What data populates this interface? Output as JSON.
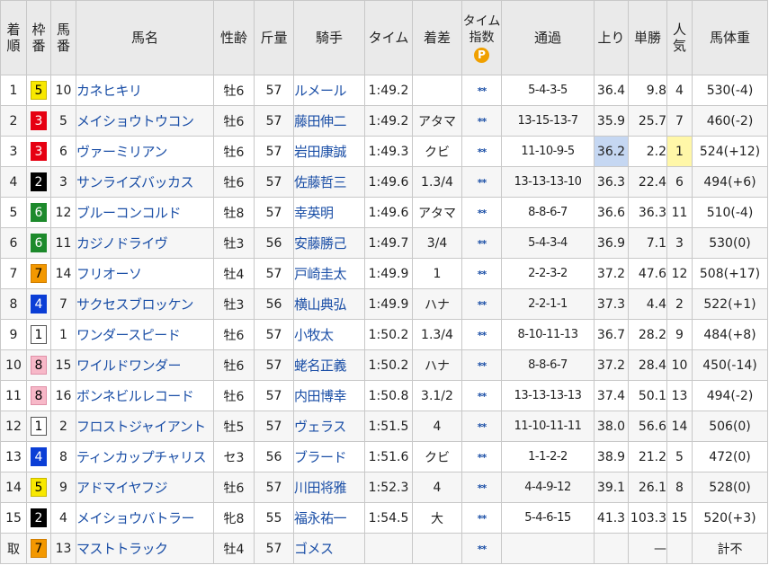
{
  "headers": {
    "rank": [
      "着",
      "順"
    ],
    "waku": [
      "枠",
      "番"
    ],
    "umaban": [
      "馬",
      "番"
    ],
    "horse": "馬名",
    "sexage": "性齢",
    "weight": "斤量",
    "jockey": "騎手",
    "time": "タイム",
    "margin": "着差",
    "index": [
      "タイム",
      "指数"
    ],
    "index_icon": "P",
    "passing": "通過",
    "agari": "上り",
    "odds": "単勝",
    "pop": [
      "人",
      "気"
    ],
    "bodyweight": "馬体重"
  },
  "waku_colors": {
    "1": "#ffffff",
    "2": "#000000",
    "3": "#e60012",
    "4": "#0b3ed6",
    "5": "#f8e800",
    "6": "#1d8a2c",
    "7": "#f39800",
    "8": "#f7b8c8"
  },
  "rows": [
    {
      "rank": "1",
      "waku": "5",
      "umaban": "10",
      "horse": "カネヒキリ",
      "sexage": "牡6",
      "weight": "57",
      "jockey": "ルメール",
      "time": "1:49.2",
      "margin": "",
      "index": "**",
      "passing": "5-4-3-5",
      "agari": "36.4",
      "odds": "9.8",
      "pop": "4",
      "bodyweight": "530(-4)"
    },
    {
      "rank": "2",
      "waku": "3",
      "umaban": "5",
      "horse": "メイショウトウコン",
      "sexage": "牡6",
      "weight": "57",
      "jockey": "藤田伸二",
      "time": "1:49.2",
      "margin": "アタマ",
      "index": "**",
      "passing": "13-15-13-7",
      "agari": "35.9",
      "odds": "25.7",
      "pop": "7",
      "bodyweight": "460(-2)"
    },
    {
      "rank": "3",
      "waku": "3",
      "umaban": "6",
      "horse": "ヴァーミリアン",
      "sexage": "牡6",
      "weight": "57",
      "jockey": "岩田康誠",
      "time": "1:49.3",
      "margin": "クビ",
      "index": "**",
      "passing": "11-10-9-5",
      "agari": "36.2",
      "odds": "2.2",
      "pop": "1",
      "bodyweight": "524(+12)"
    },
    {
      "rank": "4",
      "waku": "2",
      "umaban": "3",
      "horse": "サンライズバッカス",
      "sexage": "牡6",
      "weight": "57",
      "jockey": "佐藤哲三",
      "time": "1:49.6",
      "margin": "1.3/4",
      "index": "**",
      "passing": "13-13-13-10",
      "agari": "36.3",
      "odds": "22.4",
      "pop": "6",
      "bodyweight": "494(+6)"
    },
    {
      "rank": "5",
      "waku": "6",
      "umaban": "12",
      "horse": "ブルーコンコルド",
      "sexage": "牡8",
      "weight": "57",
      "jockey": "幸英明",
      "time": "1:49.6",
      "margin": "アタマ",
      "index": "**",
      "passing": "8-8-6-7",
      "agari": "36.6",
      "odds": "36.3",
      "pop": "11",
      "bodyweight": "510(-4)"
    },
    {
      "rank": "6",
      "waku": "6",
      "umaban": "11",
      "horse": "カジノドライヴ",
      "sexage": "牡3",
      "weight": "56",
      "jockey": "安藤勝己",
      "time": "1:49.7",
      "margin": "3/4",
      "index": "**",
      "passing": "5-4-3-4",
      "agari": "36.9",
      "odds": "7.1",
      "pop": "3",
      "bodyweight": "530(0)"
    },
    {
      "rank": "7",
      "waku": "7",
      "umaban": "14",
      "horse": "フリオーソ",
      "sexage": "牡4",
      "weight": "57",
      "jockey": "戸崎圭太",
      "time": "1:49.9",
      "margin": "1",
      "index": "**",
      "passing": "2-2-3-2",
      "agari": "37.2",
      "odds": "47.6",
      "pop": "12",
      "bodyweight": "508(+17)"
    },
    {
      "rank": "8",
      "waku": "4",
      "umaban": "7",
      "horse": "サクセスブロッケン",
      "sexage": "牡3",
      "weight": "56",
      "jockey": "横山典弘",
      "time": "1:49.9",
      "margin": "ハナ",
      "index": "**",
      "passing": "2-2-1-1",
      "agari": "37.3",
      "odds": "4.4",
      "pop": "2",
      "bodyweight": "522(+1)"
    },
    {
      "rank": "9",
      "waku": "1",
      "umaban": "1",
      "horse": "ワンダースピード",
      "sexage": "牡6",
      "weight": "57",
      "jockey": "小牧太",
      "time": "1:50.2",
      "margin": "1.3/4",
      "index": "**",
      "passing": "8-10-11-13",
      "agari": "36.7",
      "odds": "28.2",
      "pop": "9",
      "bodyweight": "484(+8)"
    },
    {
      "rank": "10",
      "waku": "8",
      "umaban": "15",
      "horse": "ワイルドワンダー",
      "sexage": "牡6",
      "weight": "57",
      "jockey": "蛯名正義",
      "time": "1:50.2",
      "margin": "ハナ",
      "index": "**",
      "passing": "8-8-6-7",
      "agari": "37.2",
      "odds": "28.4",
      "pop": "10",
      "bodyweight": "450(-14)"
    },
    {
      "rank": "11",
      "waku": "8",
      "umaban": "16",
      "horse": "ボンネビルレコード",
      "sexage": "牡6",
      "weight": "57",
      "jockey": "内田博幸",
      "time": "1:50.8",
      "margin": "3.1/2",
      "index": "**",
      "passing": "13-13-13-13",
      "agari": "37.4",
      "odds": "50.1",
      "pop": "13",
      "bodyweight": "494(-2)"
    },
    {
      "rank": "12",
      "waku": "1",
      "umaban": "2",
      "horse": "フロストジャイアント",
      "sexage": "牡5",
      "weight": "57",
      "jockey": "ヴェラス",
      "time": "1:51.5",
      "margin": "4",
      "index": "**",
      "passing": "11-10-11-11",
      "agari": "38.0",
      "odds": "56.6",
      "pop": "14",
      "bodyweight": "506(0)"
    },
    {
      "rank": "13",
      "waku": "4",
      "umaban": "8",
      "horse": "ティンカップチャリス",
      "sexage": "セ3",
      "weight": "56",
      "jockey": "ブラード",
      "time": "1:51.6",
      "margin": "クビ",
      "index": "**",
      "passing": "1-1-2-2",
      "agari": "38.9",
      "odds": "21.2",
      "pop": "5",
      "bodyweight": "472(0)"
    },
    {
      "rank": "14",
      "waku": "5",
      "umaban": "9",
      "horse": "アドマイヤフジ",
      "sexage": "牡6",
      "weight": "57",
      "jockey": "川田将雅",
      "time": "1:52.3",
      "margin": "4",
      "index": "**",
      "passing": "4-4-9-12",
      "agari": "39.1",
      "odds": "26.1",
      "pop": "8",
      "bodyweight": "528(0)"
    },
    {
      "rank": "15",
      "waku": "2",
      "umaban": "4",
      "horse": "メイショウバトラー",
      "sexage": "牝8",
      "weight": "55",
      "jockey": "福永祐一",
      "time": "1:54.5",
      "margin": "大",
      "index": "**",
      "passing": "5-4-6-15",
      "agari": "41.3",
      "odds": "103.3",
      "pop": "15",
      "bodyweight": "520(+3)"
    },
    {
      "rank": "取",
      "waku": "7",
      "umaban": "13",
      "horse": "マストトラック",
      "sexage": "牡4",
      "weight": "57",
      "jockey": "ゴメス",
      "time": "",
      "margin": "",
      "index": "**",
      "passing": "",
      "agari": "",
      "odds": "—",
      "pop": "",
      "bodyweight": "計不"
    }
  ]
}
